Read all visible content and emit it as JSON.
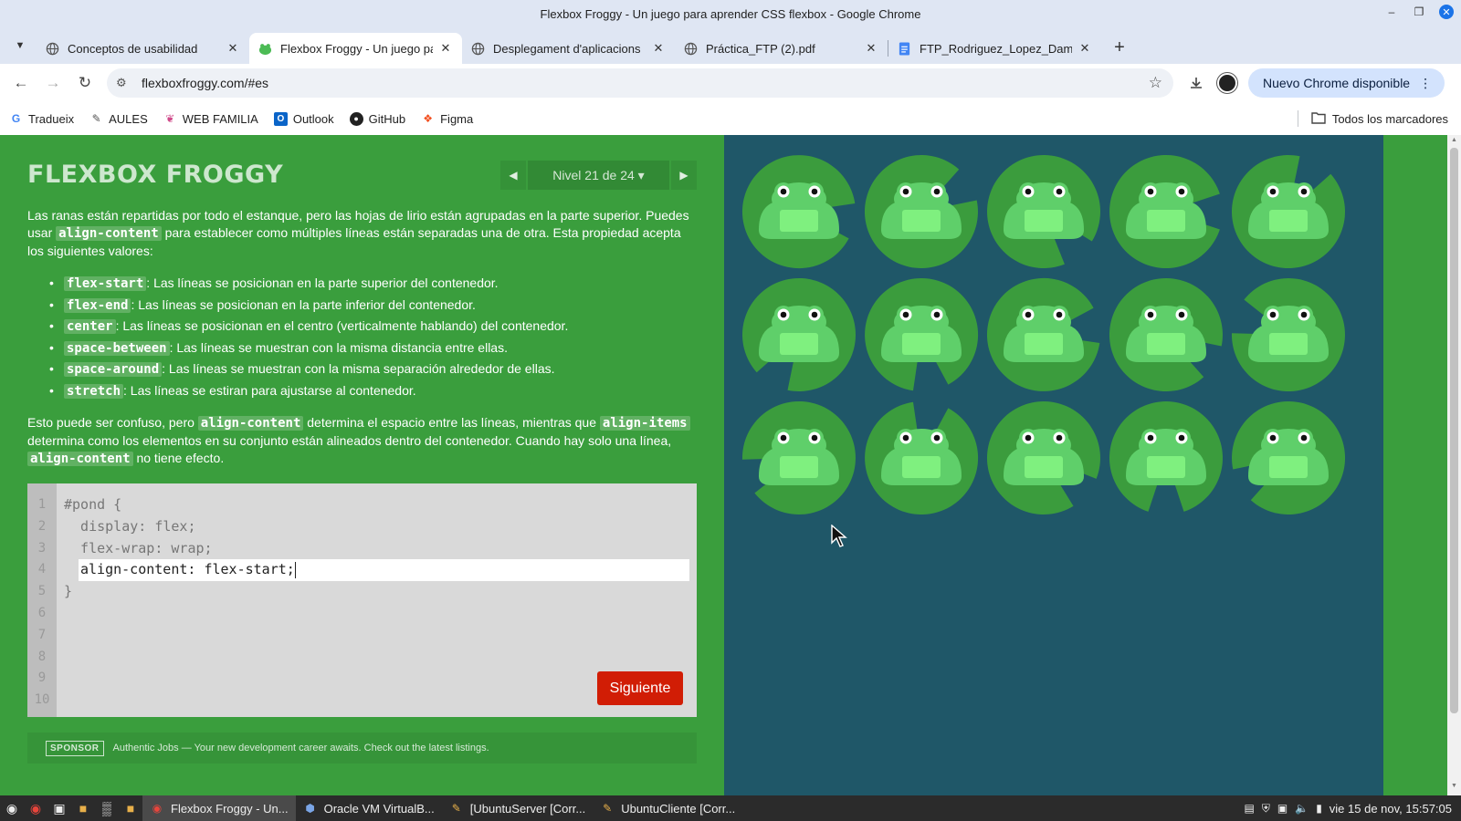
{
  "window": {
    "title": "Flexbox Froggy - Un juego para aprender CSS flexbox - Google Chrome"
  },
  "tabs": [
    {
      "label": "Conceptos de usabilidad",
      "icon": "globe-icon",
      "active": false
    },
    {
      "label": "Flexbox Froggy - Un juego para aprender CSS flexbox",
      "icon": "frog-favicon",
      "active": true
    },
    {
      "label": "Desplegament d'aplicacions",
      "icon": "globe-icon",
      "active": false
    },
    {
      "label": "Práctica_FTP (2).pdf",
      "icon": "globe-icon",
      "active": false
    },
    {
      "label": "FTP_Rodriguez_Lopez_Damián",
      "icon": "docs-icon",
      "active": false
    }
  ],
  "toolbar": {
    "url": "flexboxfroggy.com/#es",
    "update_label": "Nuevo Chrome disponible"
  },
  "bookmarks": {
    "items": [
      {
        "label": "Tradueix",
        "icon": "translate-icon"
      },
      {
        "label": "AULES",
        "icon": "moodle-icon"
      },
      {
        "label": "WEB FAMILIA",
        "icon": "family-icon"
      },
      {
        "label": "Outlook",
        "icon": "outlook-icon"
      },
      {
        "label": "GitHub",
        "icon": "github-icon"
      },
      {
        "label": "Figma",
        "icon": "figma-icon"
      }
    ],
    "all_label": "Todos los marcadores"
  },
  "game": {
    "logo": "FLEXBOX FROGGY",
    "level": "Nivel 21 de 24 ▾",
    "intro": {
      "p1": "Las ranas están repartidas por todo el estanque, pero las hojas de lirio están agrupadas en la parte superior. Puedes usar ",
      "code1": "align-content",
      "p2": " para establecer como múltiples líneas están separadas una de otra. Esta propiedad acepta los siguientes valores:"
    },
    "options": [
      {
        "code": "flex-start",
        "text": ": Las líneas se posicionan en la parte superior del contenedor."
      },
      {
        "code": "flex-end",
        "text": ": Las líneas se posicionan en la parte inferior del contenedor."
      },
      {
        "code": "center",
        "text": ": Las líneas se posicionan en el centro (verticalmente hablando) del contenedor."
      },
      {
        "code": "space-between",
        "text": ": Las líneas se muestran con la misma distancia entre ellas."
      },
      {
        "code": "space-around",
        "text": ": Las líneas se muestran con la misma separación alrededor de ellas."
      },
      {
        "code": "stretch",
        "text": ": Las líneas se estiran para ajustarse al contenedor."
      }
    ],
    "note": {
      "t1": "Esto puede ser confuso, pero ",
      "c1": "align-content",
      "t2": " determina el espacio entre las líneas, mientras que ",
      "c2": "align-items",
      "t3": " determina como los elementos en su conjunto están alineados dentro del contenedor. Cuando hay solo una línea, ",
      "c3": "align-content",
      "t4": " no tiene efecto."
    },
    "editor": {
      "line_numbers": [
        "1",
        "2",
        "3",
        "4",
        "5",
        "6",
        "7",
        "8",
        "9",
        "10"
      ],
      "line1": "#pond {",
      "line2": "  display: flex;",
      "line3": "  flex-wrap: wrap;",
      "input_value": "align-content: flex-start;",
      "line5": "}"
    },
    "next_label": "Siguiente",
    "sponsor": {
      "tag": "SPONSOR",
      "text": "Authentic Jobs — Your new development career awaits. Check out the latest listings."
    },
    "pond": {
      "frog_count": 15,
      "columns": 5,
      "pad_color": "#3b9c3d",
      "frog_color": "#5fcf6a",
      "water_color": "#1f5768"
    }
  },
  "taskbar": {
    "tasks": [
      {
        "label": "Flexbox Froggy - Un...",
        "icon": "chrome-icon",
        "active": true
      },
      {
        "label": "Oracle VM VirtualB...",
        "icon": "virtualbox-icon",
        "active": false
      },
      {
        "label": "[UbuntuServer [Corr...",
        "icon": "vm-icon",
        "active": false
      },
      {
        "label": "UbuntuCliente [Corr...",
        "icon": "vm-icon",
        "active": false
      }
    ],
    "clock": "vie 15 de nov, 15:57:05"
  }
}
